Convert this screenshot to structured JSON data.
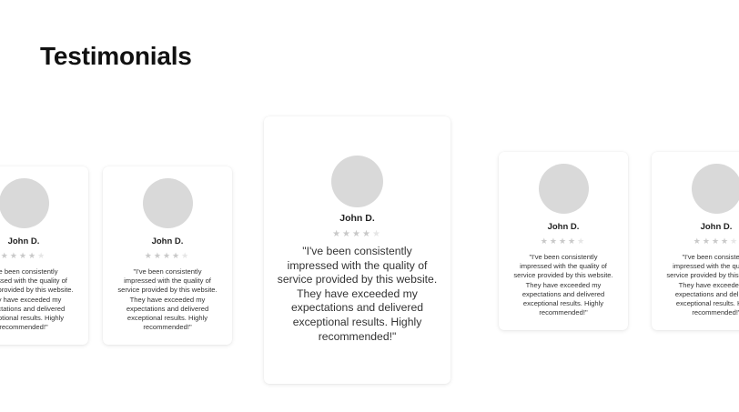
{
  "page": {
    "title": "Testimonials"
  },
  "testimonials": [
    {
      "name": "John D.",
      "rating": 4,
      "max_rating": 5,
      "quote": "\"I've been consistently impressed with the quality of service provided by this website. They have exceeded my expectations and delivered exceptional results. Highly recommended!\""
    },
    {
      "name": "John D.",
      "rating": 4,
      "max_rating": 5,
      "quote": "\"I've been consistently impressed with the quality of service provided by this website. They have exceeded my expectations and delivered exceptional results. Highly recommended!\""
    },
    {
      "name": "John D.",
      "rating": 4,
      "max_rating": 5,
      "quote": "\"I've been consistently impressed with the quality of service provided by this website. They have exceeded my expectations and delivered exceptional results. Highly recommended!\""
    },
    {
      "name": "John D.",
      "rating": 4,
      "max_rating": 5,
      "quote": "\"I've been consistently impressed with the quality of service provided by this website. They have exceeded my expectations and delivered exceptional results. Highly recommended!\""
    },
    {
      "name": "John D.",
      "rating": 4,
      "max_rating": 5,
      "quote": "\"I've been consistently impressed with the quality of service provided by this website. They have exceeded my expectations and delivered exceptional results. Highly recommended!\""
    }
  ],
  "colors": {
    "avatar_placeholder": "#d9d9d9",
    "star_filled": "#c9c9c9",
    "star_empty": "#e6e6e6",
    "card_background": "#ffffff"
  },
  "icons": {
    "star": "star-icon"
  }
}
